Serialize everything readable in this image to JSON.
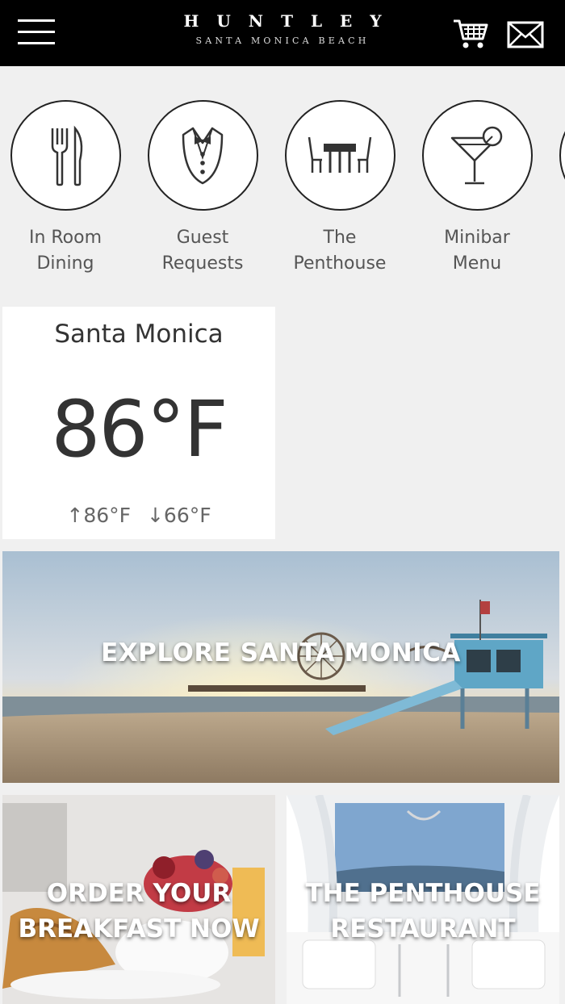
{
  "header": {
    "logo_main": "HUNTLEY",
    "logo_sub": "SANTA MONICA BEACH",
    "icons": [
      "menu-icon",
      "cart-icon",
      "mail-icon"
    ]
  },
  "services": [
    {
      "line1": "In Room",
      "line2": "Dining",
      "icon": "fork-knife-icon"
    },
    {
      "line1": "Guest",
      "line2": "Requests",
      "icon": "butler-icon"
    },
    {
      "line1": "The",
      "line2": "Penthouse",
      "icon": "dining-table-icon"
    },
    {
      "line1": "Minibar",
      "line2": "Menu",
      "icon": "cocktail-icon"
    }
  ],
  "weather": {
    "city": "Santa Monica",
    "temp": "86°F",
    "high": "↑86°F",
    "low": "↓66°F"
  },
  "tiles": {
    "explore": "EXPLORE SANTA MONICA",
    "breakfast_line1": "ORDER YOUR",
    "breakfast_line2": "BREAKFAST NOW",
    "penthouse_line1": "THE PENTHOUSE",
    "penthouse_line2": "RESTAURANT"
  },
  "colors": {
    "header_bg": "#000000",
    "page_bg": "#f0f0f0",
    "text": "#333333"
  }
}
